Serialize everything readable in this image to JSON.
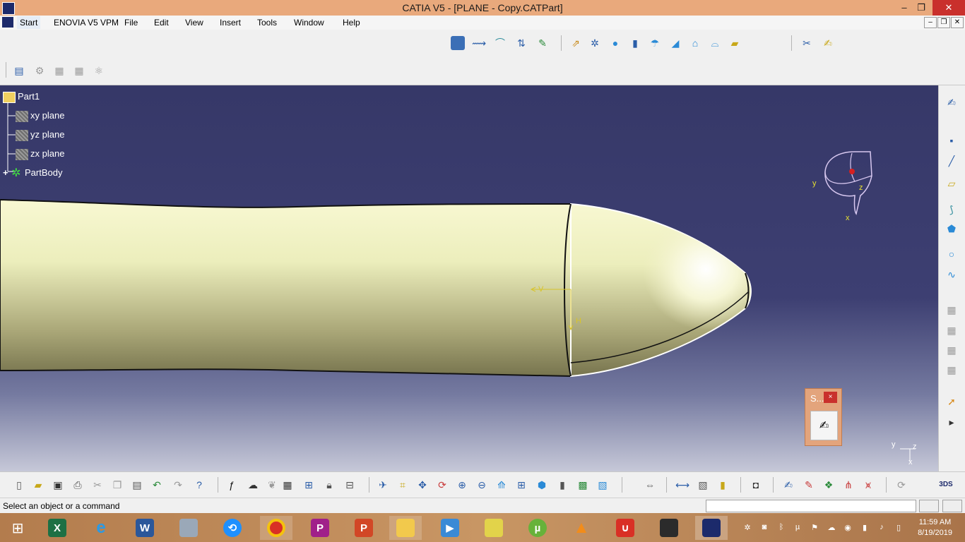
{
  "window": {
    "title": "CATIA V5 - [PLANE - Copy.CATPart]",
    "minimize": "–",
    "maximize": "❐",
    "close": "✕"
  },
  "menu": {
    "items": [
      "Start",
      "ENOVIA V5 VPM",
      "File",
      "Edit",
      "View",
      "Insert",
      "Tools",
      "Window",
      "Help"
    ],
    "mdi_min": "–",
    "mdi_restore": "❐",
    "mdi_close": "✕"
  },
  "tree": {
    "root": "Part1",
    "children": [
      "xy plane",
      "yz plane",
      "zx plane",
      "PartBody"
    ]
  },
  "viewport": {
    "compass_labels": {
      "y": "y",
      "z": "z",
      "x": "x"
    },
    "sketch_labels": {
      "v": "V",
      "h": "H"
    },
    "mini_axis": {
      "y": "y",
      "z": "z",
      "x": "x"
    }
  },
  "sketch_toolbar": {
    "title": "S...",
    "close": "×"
  },
  "status": {
    "message": "Select an object or a command"
  },
  "taskbar": {
    "time": "11:59 AM",
    "date": "8/19/2019"
  },
  "colors": {
    "title_bar": "#e9a97c",
    "viewport_top": "#363868",
    "part_body": "#f4f4c6",
    "taskbar": "#c89664"
  }
}
